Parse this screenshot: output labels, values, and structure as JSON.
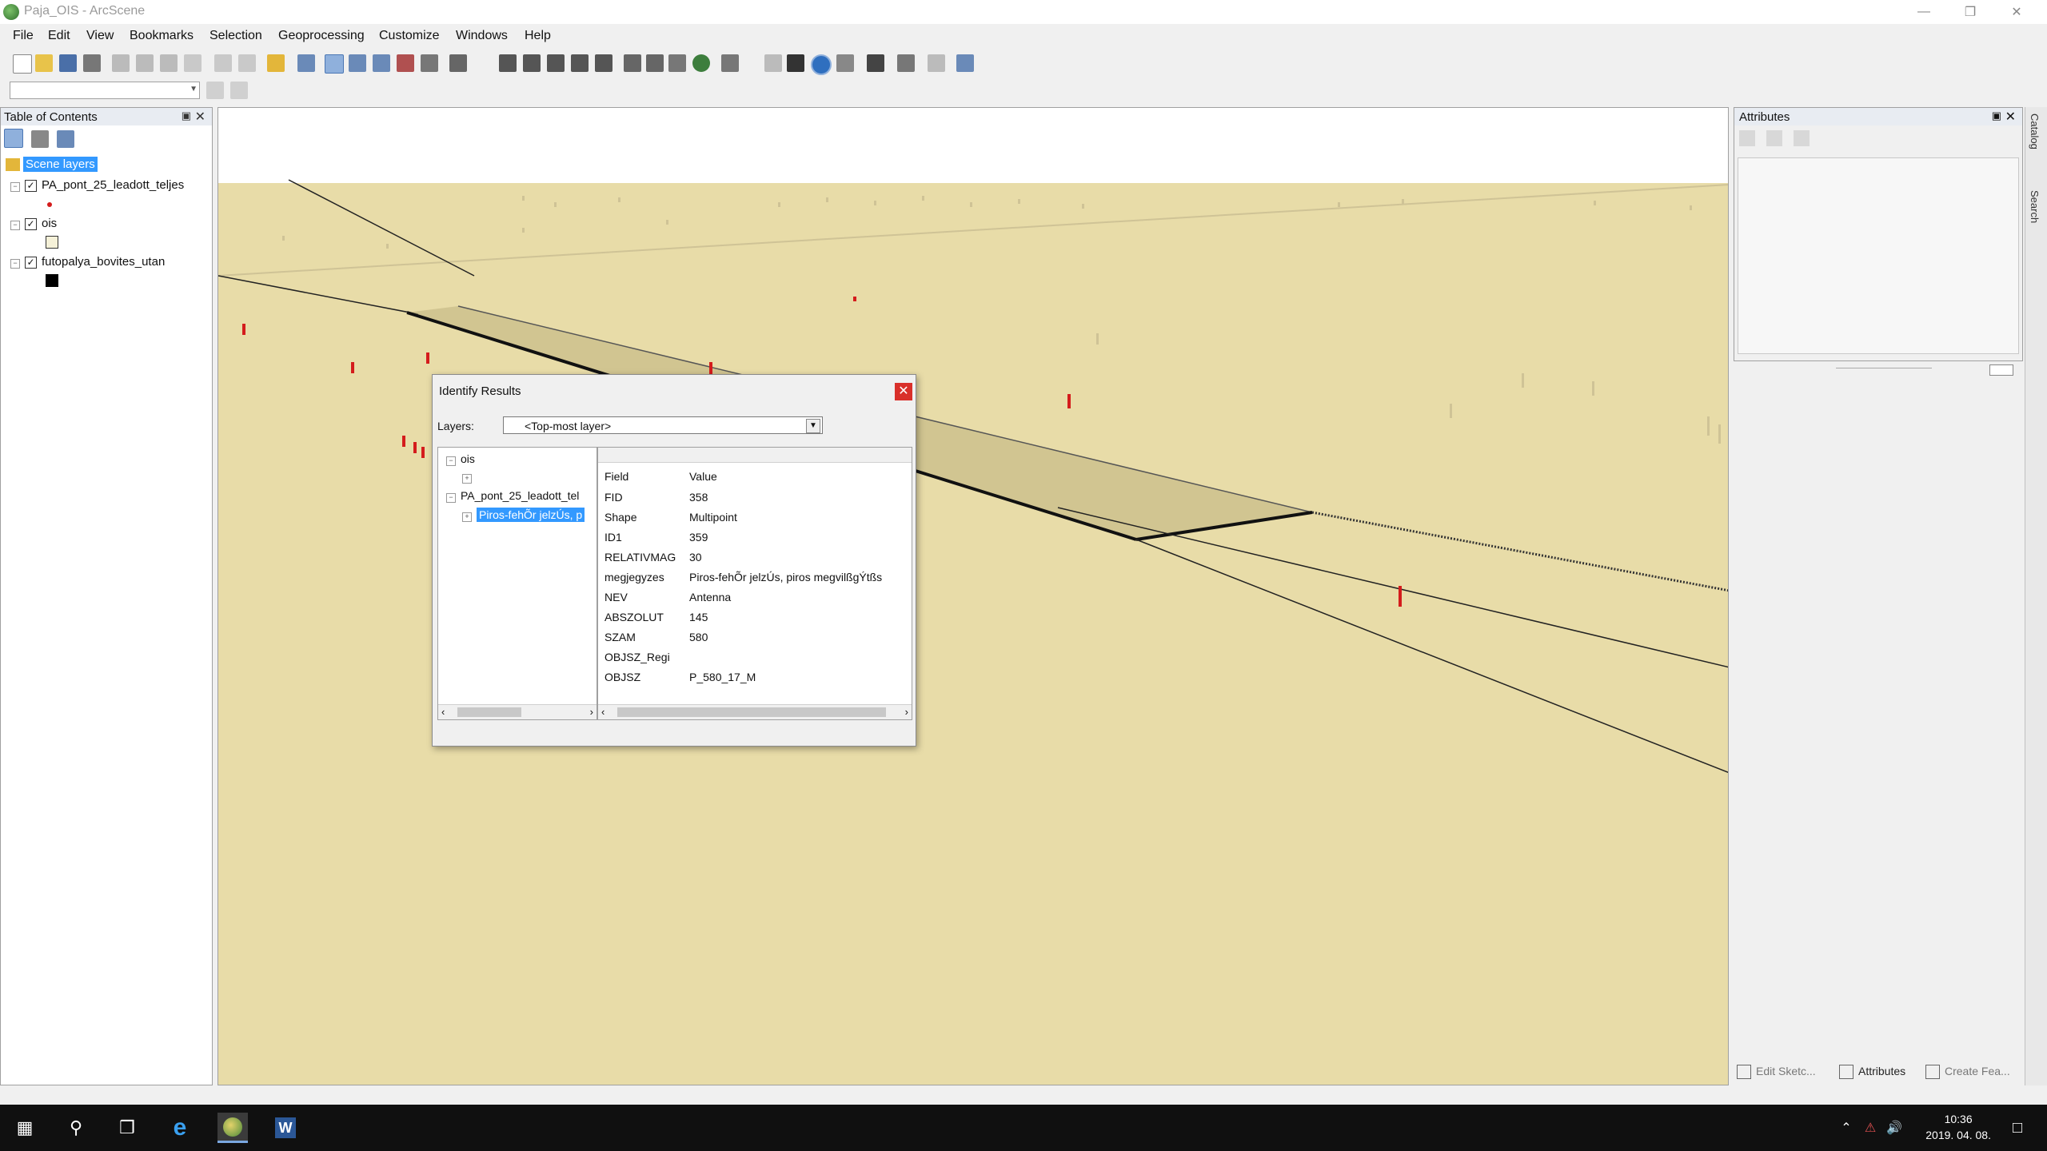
{
  "window": {
    "title": "Paja_OIS - ArcScene"
  },
  "menu": [
    "File",
    "Edit",
    "View",
    "Bookmarks",
    "Selection",
    "Geoprocessing",
    "Customize",
    "Windows",
    "Help"
  ],
  "toc": {
    "title": "Table of Contents",
    "root": "Scene layers",
    "layers": [
      {
        "name": "PA_pont_25_leadott_teljes",
        "checked": true
      },
      {
        "name": "ois",
        "checked": true
      },
      {
        "name": "futopalya_bovites_utan",
        "checked": true
      }
    ]
  },
  "attributes_panel": {
    "title": "Attributes"
  },
  "side_tabs": [
    "Catalog",
    "Search"
  ],
  "bottom_tabs": [
    "Edit Sketc...",
    "Attributes",
    "Create Fea..."
  ],
  "identify": {
    "title": "Identify Results",
    "layers_label": "Layers:",
    "layers_value": "<Top-most layer>",
    "tree": {
      "node1": "ois",
      "node2": "PA_pont_25_leadott_tel",
      "node2_child": "Piros-fehÕr jelzÚs, p"
    },
    "header": {
      "field": "Field",
      "value": "Value"
    },
    "rows": [
      {
        "field": "FID",
        "value": "358"
      },
      {
        "field": "Shape",
        "value": "Multipoint"
      },
      {
        "field": "ID1",
        "value": "359"
      },
      {
        "field": "RELATIVMAG",
        "value": "30"
      },
      {
        "field": "megjegyzes",
        "value": "Piros-fehÕr jelzÚs, piros megvilßgÝtßs"
      },
      {
        "field": "NEV",
        "value": "Antenna"
      },
      {
        "field": "ABSZOLUT",
        "value": "145"
      },
      {
        "field": "SZAM",
        "value": "580"
      },
      {
        "field": "OBJSZ_Regi",
        "value": ""
      },
      {
        "field": "OBJSZ",
        "value": "P_580_17_M"
      }
    ]
  },
  "clock": {
    "time": "10:36",
    "date": "2019. 04. 08."
  },
  "colors": {
    "ground": "#e8dca8",
    "marker": "#d41c1c",
    "selection": "#3399ff",
    "close": "#d9302a"
  }
}
